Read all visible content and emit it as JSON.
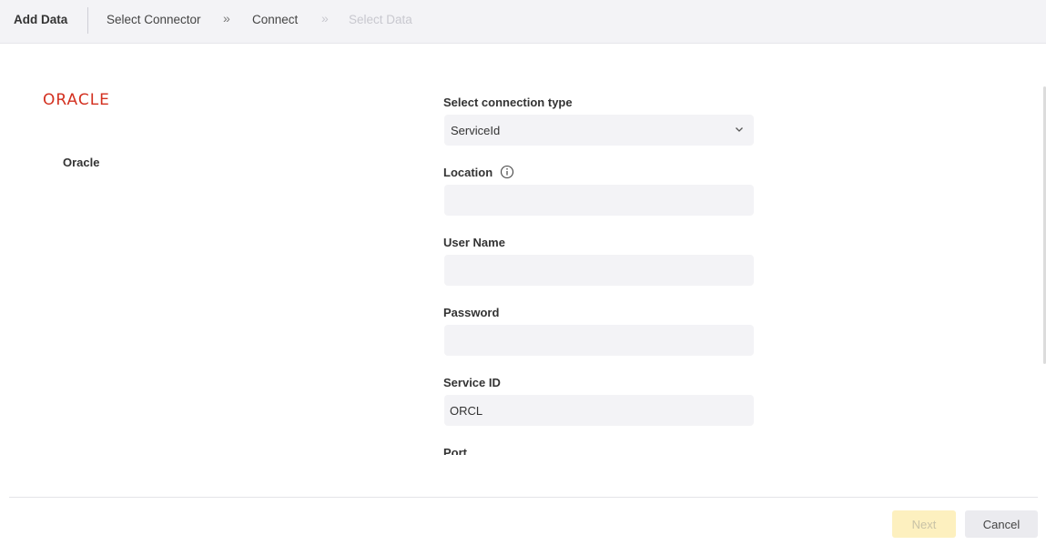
{
  "header": {
    "title": "Add Data",
    "steps": [
      {
        "label": "Select Connector"
      },
      {
        "label": "Connect"
      },
      {
        "label": "Select Data"
      }
    ],
    "separator": "»"
  },
  "connector": {
    "logo_text": "ORACLE",
    "name": "Oracle"
  },
  "form": {
    "connection_type": {
      "label": "Select connection type",
      "value": "ServiceId"
    },
    "location": {
      "label": "Location",
      "value": ""
    },
    "user_name": {
      "label": "User Name",
      "value": ""
    },
    "password": {
      "label": "Password",
      "value": ""
    },
    "service_id": {
      "label": "Service ID",
      "value": "ORCL"
    },
    "port": {
      "label": "Port"
    }
  },
  "footer": {
    "next_label": "Next",
    "cancel_label": "Cancel"
  },
  "colors": {
    "brand": "#d3301f",
    "field_bg": "#f3f3f6",
    "next_disabled_bg": "#fdf0bf"
  }
}
